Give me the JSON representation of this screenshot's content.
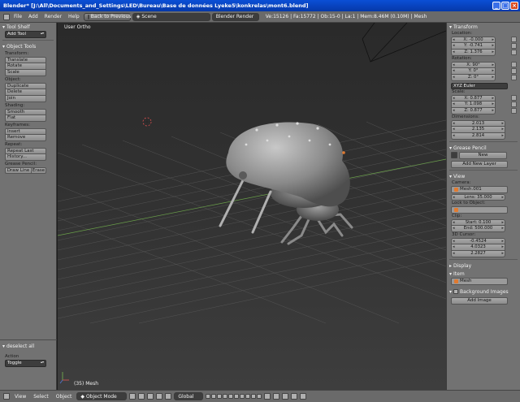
{
  "window": {
    "title": "Blender* [J:\\All\\Documents_and_Settings\\LED\\Bureau\\Base de données Lyeke5\\konkrelas\\mont6.blend]"
  },
  "info_header": {
    "menus": [
      "File",
      "Add",
      "Render",
      "Help"
    ],
    "screen_layout": "Back to Previous",
    "scene": "Scene",
    "render_engine": "Blender Render",
    "stats": "Ve:15126 | Fa:15772 | Ob:15-0 | La:1 | Mem:8.46M (0.10M) | Mesh"
  },
  "toolshelf": {
    "title": "Tool Shelf",
    "add_tool": "Add Tool",
    "object_tools_title": "Object Tools",
    "sections": [
      {
        "label": "Transform:",
        "buttons": [
          "Translate",
          "Rotate",
          "Scale"
        ]
      },
      {
        "label": "Object:",
        "buttons": [
          "Duplicate",
          "Delete",
          "Join"
        ]
      },
      {
        "label": "Shading:",
        "buttons": [
          "Smooth",
          "Flat"
        ]
      },
      {
        "label": "Keyframes:",
        "buttons": [
          "Insert",
          "Remove"
        ]
      },
      {
        "label": "Repeat:",
        "buttons": [
          "Repeat Last",
          "History..."
        ]
      }
    ],
    "grease_pencil_label": "Grease Pencil:",
    "draw_line": "Draw Line",
    "erase": "Erase",
    "operator_title": "deselect all",
    "action_label": "Action",
    "action_value": "Toggle"
  },
  "viewport": {
    "view_name": "User Ortho",
    "object_label": "(35) Mesh"
  },
  "properties": {
    "transform_title": "Transform",
    "location_label": "Location:",
    "location": [
      "X: -0.000",
      "Y: -0.741",
      "Z: 1.376"
    ],
    "rotation_label": "Rotation:",
    "rotation": [
      "X: 90°",
      "Y: 0°",
      "Z: 0°"
    ],
    "rotation_mode": "XYZ Euler",
    "scale_label": "Scale:",
    "scale": [
      "X: 0.877",
      "Y: 1.098",
      "Z: 0.877"
    ],
    "dimensions_label": "Dimensions:",
    "dimensions": [
      "2.013",
      "2.135",
      "2.814"
    ],
    "grease_pencil_title": "Grease Pencil",
    "new_label": "New",
    "add_new_layer": "Add New Layer",
    "view_title": "View",
    "camera_label": "Camera:",
    "camera_value": "Mesh.001",
    "lens": "Lens: 35.000",
    "lock_label": "Lock to Object:",
    "clip_label": "Clip:",
    "clip_start": "Start: 0.100",
    "clip_end": "End: 500.000",
    "cursor_label": "3D Cursor:",
    "cursor": [
      "-0.4524",
      "4.0323",
      "2.2827"
    ],
    "display_title": "Display",
    "item_title": "Item",
    "item_name": "Mesh",
    "bg_images_title": "Background Images",
    "add_image": "Add Image"
  },
  "bottom_bar": {
    "menus": [
      "View",
      "Select",
      "Object"
    ],
    "mode": "Object Mode",
    "pivot": "Global"
  }
}
